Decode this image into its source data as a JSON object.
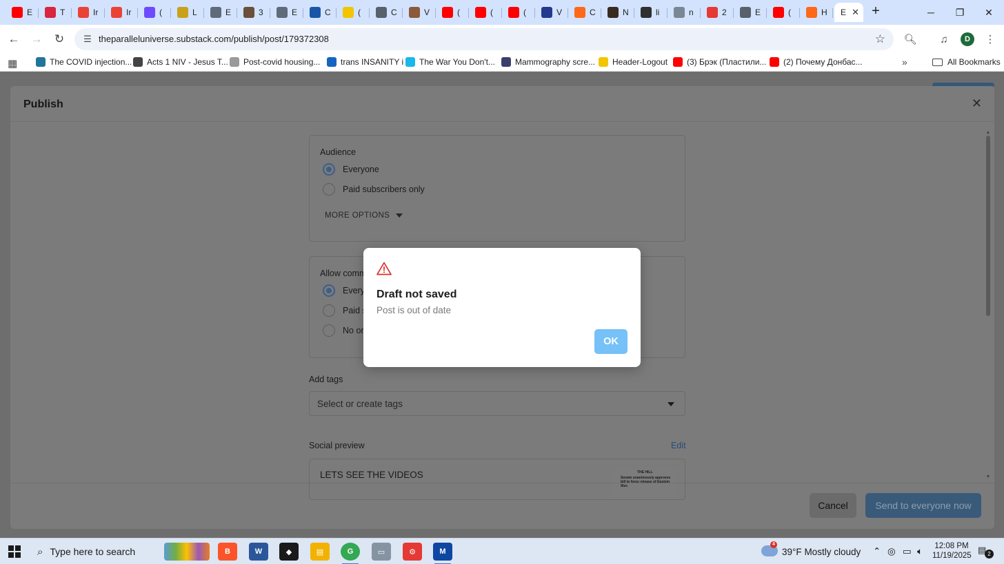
{
  "browser": {
    "tabs": [
      {
        "letter": "E",
        "icon": "youtube-icon",
        "color": "#ff0000"
      },
      {
        "letter": "T",
        "icon": "circle-red-icon",
        "color": "#d7263d"
      },
      {
        "letter": "Ir",
        "icon": "gmail-icon",
        "color": "#ea4335"
      },
      {
        "letter": "Ir",
        "icon": "gmail-icon",
        "color": "#ea4335"
      },
      {
        "letter": "(",
        "icon": "proton-mail-icon",
        "color": "#6d4aff"
      },
      {
        "letter": "L",
        "icon": "bird-icon",
        "color": "#c8a21b"
      },
      {
        "letter": "E",
        "icon": "globe-icon",
        "color": "#5f6b7a"
      },
      {
        "letter": "3",
        "icon": "avatar-icon",
        "color": "#6b4f3a"
      },
      {
        "letter": "E",
        "icon": "globe-icon",
        "color": "#5f6b7a"
      },
      {
        "letter": "C",
        "icon": "seal-icon",
        "color": "#1a56a8"
      },
      {
        "letter": "(",
        "icon": "aol-icon",
        "color": "#f2c500"
      },
      {
        "letter": "C",
        "icon": "car-icon",
        "color": "#58606b"
      },
      {
        "letter": "V",
        "icon": "image-icon",
        "color": "#8a5a3b"
      },
      {
        "letter": "(",
        "icon": "youtube-icon",
        "color": "#ff0000"
      },
      {
        "letter": "(",
        "icon": "youtube-icon",
        "color": "#ff0000"
      },
      {
        "letter": "(",
        "icon": "youtube-icon",
        "color": "#ff0000"
      },
      {
        "letter": "V",
        "icon": "globe-icon",
        "color": "#243a8f"
      },
      {
        "letter": "C",
        "icon": "substack-icon",
        "color": "#ff6719"
      },
      {
        "letter": "N",
        "icon": "avatar-icon",
        "color": "#3a2a20"
      },
      {
        "letter": "li",
        "icon": "avatar-icon",
        "color": "#2f2f2f"
      },
      {
        "letter": "n",
        "icon": "globe-icon",
        "color": "#7a8794"
      },
      {
        "letter": "2",
        "icon": "swirl-icon",
        "color": "#e53935"
      },
      {
        "letter": "E",
        "icon": "car-icon",
        "color": "#58606b"
      },
      {
        "letter": "(",
        "icon": "youtube-icon",
        "color": "#ff0000"
      },
      {
        "letter": "H",
        "icon": "substack-icon",
        "color": "#ff6719"
      }
    ],
    "active_tab": {
      "letter": "E"
    },
    "new_tab": "+",
    "url": "theparalleluniverse.substack.com/publish/post/179372308",
    "profile_letter": "D",
    "bookmarks": [
      {
        "label": "The COVID injection...",
        "icon": "wordpress-icon",
        "color": "#21759b"
      },
      {
        "label": "Acts 1 NIV - Jesus T...",
        "icon": "globe-icon",
        "color": "#444444"
      },
      {
        "label": "Post-covid housing...",
        "icon": "bars-icon",
        "color": "#9a9a9a"
      },
      {
        "label": "trans INSANITY i",
        "icon": "lifesite-icon",
        "color": "#1565c0"
      },
      {
        "label": "The War You Don't...",
        "icon": "vimeo-icon",
        "color": "#1ab7ea"
      },
      {
        "label": "Mammography scre...",
        "icon": "tag-icon",
        "color": "#3a3f6b"
      },
      {
        "label": "Header-Logout",
        "icon": "aol-icon",
        "color": "#f2c500"
      },
      {
        "label": "(3) Брэк (Пластили...",
        "icon": "youtube-icon",
        "color": "#ff0000"
      },
      {
        "label": "(2) Почему Донбас...",
        "icon": "youtube-icon",
        "color": "#ff0000"
      }
    ],
    "all_bookmarks": "All Bookmarks"
  },
  "publish": {
    "title": "Publish",
    "audience": {
      "title": "Audience",
      "options": [
        "Everyone",
        "Paid subscribers only"
      ],
      "selected": "Everyone",
      "more_options": "MORE OPTIONS"
    },
    "comments": {
      "title": "Allow comments from...",
      "options": [
        "Everyone",
        "Paid subscribers",
        "No one"
      ],
      "selected": "Everyone"
    },
    "tags": {
      "label": "Add tags",
      "placeholder": "Select or create tags"
    },
    "social_preview": {
      "label": "Social preview",
      "edit": "Edit",
      "post_title": "LETS SEE THE VIDEOS",
      "thumb_masthead": "THE HILL",
      "thumb_headline": "Senate unanimously approves bill to force release of Epstein files"
    },
    "footer": {
      "cancel": "Cancel",
      "send": "Send to everyone now"
    }
  },
  "dialog": {
    "title": "Draft not saved",
    "message": "Post is out of date",
    "ok": "OK"
  },
  "taskbar": {
    "search_placeholder": "Type here to search",
    "weather_badge": "4",
    "temperature": "39°F",
    "weather": "Mostly cloudy",
    "time": "12:08 PM",
    "date": "11/19/2025",
    "notification_count": "2"
  },
  "colors": {
    "accent": "#76c1f7",
    "warning": "#d93025",
    "overlay": "#6e6e6e"
  }
}
